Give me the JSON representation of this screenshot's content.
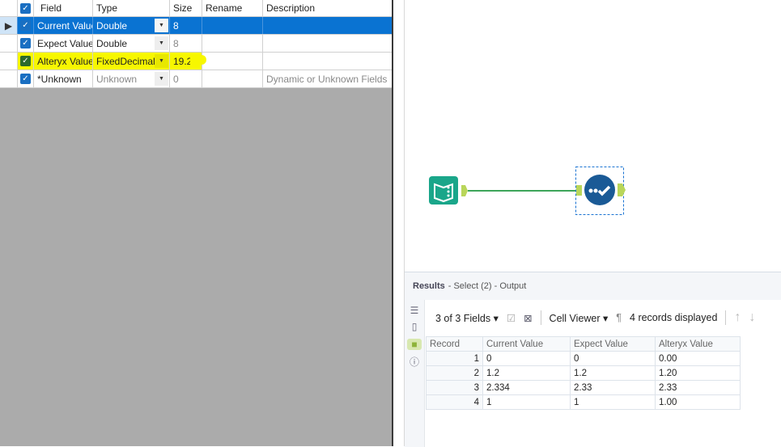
{
  "grid": {
    "headers": {
      "field": "Field",
      "type": "Type",
      "size": "Size",
      "rename": "Rename",
      "description": "Description"
    },
    "rows": [
      {
        "field": "Current Value",
        "type": "Double",
        "size": "8",
        "rename": "",
        "description": ""
      },
      {
        "field": "Expect Value",
        "type": "Double",
        "size": "8",
        "rename": "",
        "description": ""
      },
      {
        "field": "Alteryx Value",
        "type": "FixedDecimal",
        "size": "19.2",
        "rename": "",
        "description": ""
      },
      {
        "field": "*Unknown",
        "type": "Unknown",
        "size": "0",
        "rename": "",
        "description": "Dynamic or Unknown Fields"
      }
    ]
  },
  "results": {
    "title": "Results",
    "subtitle": "- Select (2) - Output",
    "fields": "3 of 3 Fields",
    "viewer": "Cell Viewer",
    "records": "4 records displayed",
    "columns": [
      "Record",
      "Current Value",
      "Expect Value",
      "Alteryx Value"
    ],
    "rows": [
      [
        "1",
        "0",
        "0",
        "0.00"
      ],
      [
        "2",
        "1.2",
        "1.2",
        "1.20"
      ],
      [
        "3",
        "2.334",
        "2.33",
        "2.33"
      ],
      [
        "4",
        "1",
        "1",
        "1.00"
      ]
    ]
  },
  "colors": {
    "selection": "#0a73d2",
    "highlight": "#f7f700",
    "accent": "#1a5a96",
    "input": "#1aa68a"
  }
}
